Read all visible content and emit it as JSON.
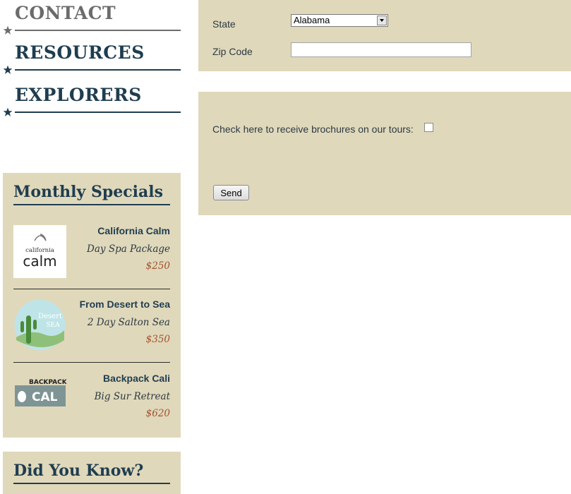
{
  "nav": {
    "contact": "CONTACT",
    "resources": "RESOURCES",
    "explorers": "EXPLORERS"
  },
  "specials": {
    "title": "Monthly Specials",
    "items": [
      {
        "name": "California Calm",
        "desc": "Day Spa Package",
        "price": "$250",
        "logo_text": [
          "california",
          "calm"
        ]
      },
      {
        "name": "From Desert to Sea",
        "desc": "2 Day Salton Sea",
        "price": "$350",
        "logo_text": [
          "Desert",
          "SEA"
        ]
      },
      {
        "name": "Backpack Cali",
        "desc": "Big Sur Retreat",
        "price": "$620",
        "logo_text": [
          "BACKPACK",
          "CAL"
        ]
      }
    ]
  },
  "did_you_know": {
    "title": "Did You Know?"
  },
  "form": {
    "state_label": "State",
    "state_value": "Alabama",
    "zip_label": "Zip Code",
    "zip_value": "",
    "brochure_label": "Check here to receive brochures on our tours:",
    "send_label": "Send"
  },
  "colors": {
    "panel_bg": "#e0d8bb",
    "heading": "#1f3d4f",
    "price": "#a0522d",
    "contact_gray": "#6b6b6b"
  }
}
